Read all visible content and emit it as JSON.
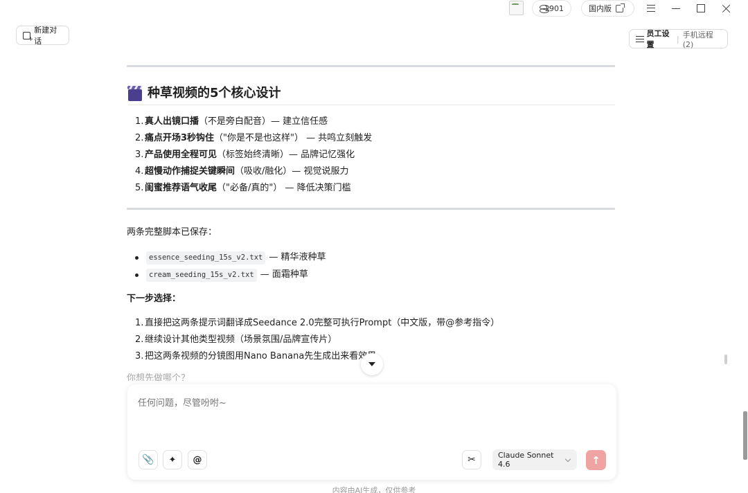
{
  "titlebar": {
    "credits": "1901",
    "region": "国内版"
  },
  "header": {
    "new_chat": "新建对话",
    "staff_settings": "员工设置",
    "staff_separator": "|",
    "mobile_remote": "手机远程 (2)"
  },
  "content": {
    "section_title": "种草视频的5个核心设计",
    "core_design": [
      {
        "num": "1.",
        "bold": "真人出镜口播",
        "rest": "（不是旁白配音）— 建立信任感"
      },
      {
        "num": "2.",
        "bold": "痛点开场3秒钩住",
        "rest": "（\"你是不是也这样\"） — 共鸣立刻触发"
      },
      {
        "num": "3.",
        "bold": "产品使用全程可见",
        "rest": "（标签始终清晰）— 品牌记忆强化"
      },
      {
        "num": "4.",
        "bold": "超慢动作捕捉关键瞬间",
        "rest": "（吸收/融化）— 视觉说服力"
      },
      {
        "num": "5.",
        "bold": "闺蜜推荐语气收尾",
        "rest": "（\"必备/真的\"） — 降低决策门槛"
      }
    ],
    "saved_intro": "两条完整脚本已保存：",
    "saved_files": [
      {
        "file": "essence_seeding_15s_v2.txt",
        "desc": "— 精华液种草"
      },
      {
        "file": "cream_seeding_15s_v2.txt",
        "desc": "— 面霜种草"
      }
    ],
    "next_title": "下一步选择：",
    "next_steps": [
      {
        "num": "1.",
        "text": "直接把这两条提示词翻译成Seedance 2.0完整可执行Prompt（中文版，带@参考指令）"
      },
      {
        "num": "2.",
        "text": "继续设计其他类型视频（场景氛围/品牌宣传片）"
      },
      {
        "num": "3.",
        "text": "把这两条视频的分镜图用Nano Banana先生成出来看效果"
      }
    ],
    "question": "你想先做哪个？"
  },
  "composer": {
    "placeholder": "任何问题，尽管吩咐~",
    "model": "Claude Sonnet 4.6"
  },
  "footer": {
    "note": "内容由AI生成，仅供参考"
  },
  "colors": {
    "send_button": "#f0a3a3",
    "divider": "#d7dade"
  }
}
